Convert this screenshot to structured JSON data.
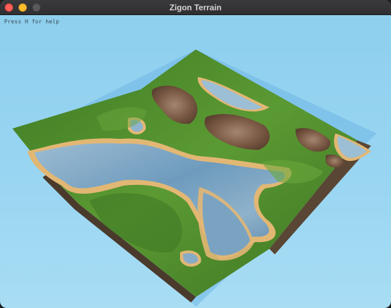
{
  "window": {
    "title": "Zigon Terrain"
  },
  "viewport": {
    "help_text": "Press H for help"
  },
  "colors": {
    "sky": "#8fd0ee",
    "water": "#7fa9c6",
    "sand": "#e2b774",
    "grass": "#4f8a2e",
    "mountain": "#7a5a45"
  },
  "icons": [
    "close-icon",
    "minimize-icon",
    "zoom-icon"
  ]
}
